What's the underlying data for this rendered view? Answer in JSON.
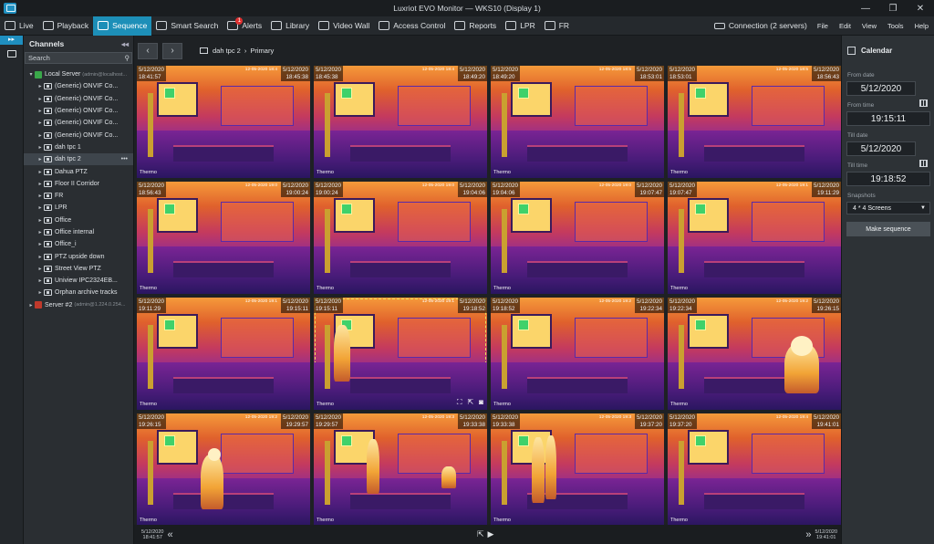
{
  "window": {
    "title": "Luxriot EVO Monitor — WKS10 (Display 1)",
    "min": "—",
    "max": "❐",
    "close": "✕"
  },
  "menu": {
    "items": [
      {
        "label": "Live",
        "icon": "monitor-icon",
        "active": false
      },
      {
        "label": "Playback",
        "icon": "play-icon",
        "active": false
      },
      {
        "label": "Sequence",
        "icon": "sequence-icon",
        "active": true
      },
      {
        "label": "Smart Search",
        "icon": "smart-search-icon",
        "active": false
      },
      {
        "label": "Alerts",
        "icon": "bell-icon",
        "active": false,
        "badge": "1"
      },
      {
        "label": "Library",
        "icon": "library-icon",
        "active": false
      },
      {
        "label": "Video Wall",
        "icon": "video-wall-icon",
        "active": false
      },
      {
        "label": "Access Control",
        "icon": "access-control-icon",
        "active": false
      },
      {
        "label": "Reports",
        "icon": "reports-icon",
        "active": false
      },
      {
        "label": "LPR",
        "icon": "lpr-icon",
        "active": false
      },
      {
        "label": "FR",
        "icon": "fr-icon",
        "active": false
      }
    ],
    "connection": "Connection (2 servers)",
    "right": [
      "File",
      "Edit",
      "View",
      "Tools",
      "Help"
    ]
  },
  "channels": {
    "title": "Channels",
    "search_placeholder": "Search",
    "tree": [
      {
        "label": "Local Server",
        "sub": "(admin@localhost...",
        "kind": "server",
        "color": "#3aa84a"
      },
      {
        "label": "(Generic) ONVIF Co...",
        "kind": "camera"
      },
      {
        "label": "(Generic) ONVIF Co...",
        "kind": "camera"
      },
      {
        "label": "(Generic) ONVIF Co...",
        "kind": "camera"
      },
      {
        "label": "(Generic) ONVIF Co...",
        "kind": "camera"
      },
      {
        "label": "(Generic) ONVIF Co...",
        "kind": "camera"
      },
      {
        "label": "dah tpc 1",
        "kind": "camera"
      },
      {
        "label": "dah tpc 2",
        "kind": "camera",
        "selected": true
      },
      {
        "label": "Dahua PTZ",
        "kind": "camera"
      },
      {
        "label": "Floor II Corridor",
        "kind": "camera"
      },
      {
        "label": "FR",
        "kind": "camera"
      },
      {
        "label": "LPR",
        "kind": "camera"
      },
      {
        "label": "Office",
        "kind": "camera"
      },
      {
        "label": "Office internal",
        "kind": "camera"
      },
      {
        "label": "Office_i",
        "kind": "camera"
      },
      {
        "label": "PTZ upside down",
        "kind": "camera"
      },
      {
        "label": "Street View PTZ",
        "kind": "camera"
      },
      {
        "label": "Uniview IPC2324EB...",
        "kind": "camera"
      },
      {
        "label": "Orphan archive tracks",
        "kind": "camera"
      },
      {
        "label": "Server #2",
        "sub": "(admin@1.224.0.254...",
        "kind": "server",
        "color": "#c0392b"
      }
    ]
  },
  "viewer": {
    "breadcrumb": {
      "camera": "dah tpc 2",
      "stream": "Primary"
    },
    "tiles": [
      {
        "date": "5/12/2020",
        "start": "18:41:57",
        "end": "18:45:38",
        "ts": "12-05-2020 18:4"
      },
      {
        "date": "5/12/2020",
        "start": "18:45:38",
        "end": "18:49:20",
        "ts": "12-05-2020 18:4"
      },
      {
        "date": "5/12/2020",
        "start": "18:49:20",
        "end": "18:53:01",
        "ts": "12-05-2020 18:5"
      },
      {
        "date": "5/12/2020",
        "start": "18:53:01",
        "end": "18:56:43",
        "ts": "12-05-2020 18:5"
      },
      {
        "date": "5/12/2020",
        "start": "18:56:43",
        "end": "19:00:24",
        "ts": "12-05-2020 19:0"
      },
      {
        "date": "5/12/2020",
        "start": "19:00:24",
        "end": "19:04:06",
        "ts": "12-05-2020 19:0"
      },
      {
        "date": "5/12/2020",
        "start": "19:04:06",
        "end": "19:07:47",
        "ts": "12-05-2020 19:0"
      },
      {
        "date": "5/12/2020",
        "start": "19:07:47",
        "end": "19:11:29",
        "ts": "12-05-2020 19:1"
      },
      {
        "date": "5/12/2020",
        "start": "19:11:29",
        "end": "19:15:11",
        "ts": "12-05-2020 19:1"
      },
      {
        "date": "5/12/2020",
        "start": "19:15:11",
        "end": "19:18:52",
        "ts": "12-05-2020 19:1",
        "selected": true
      },
      {
        "date": "5/12/2020",
        "start": "19:18:52",
        "end": "19:22:34",
        "ts": "12-05-2020 19:2"
      },
      {
        "date": "5/12/2020",
        "start": "19:22:34",
        "end": "19:26:15",
        "ts": "12-05-2020 19:2"
      },
      {
        "date": "5/12/2020",
        "start": "19:26:15",
        "end": "19:29:57",
        "ts": "12-05-2020 19:2"
      },
      {
        "date": "5/12/2020",
        "start": "19:29:57",
        "end": "19:33:38",
        "ts": "12-05-2020 19:3"
      },
      {
        "date": "5/12/2020",
        "start": "19:33:38",
        "end": "19:37:20",
        "ts": "12-05-2020 19:3"
      },
      {
        "date": "5/12/2020",
        "start": "19:37:20",
        "end": "19:41:01",
        "ts": "12-05-2020 19:4"
      }
    ],
    "tile_label": "Thermo",
    "timeline": {
      "start_date": "5/12/2020",
      "start_time": "18:41:57",
      "end_date": "5/12/2020",
      "end_time": "19:41:01"
    }
  },
  "calendar": {
    "title": "Calendar",
    "from_date_label": "From date",
    "from_date": "5/12/2020",
    "from_time_label": "From time",
    "from_time": "19:15:11",
    "till_date_label": "Till date",
    "till_date": "5/12/2020",
    "till_time_label": "Till time",
    "till_time": "19:18:52",
    "snapshots_label": "Snapshots",
    "snapshots_value": "4 * 4 Screens",
    "make_sequence": "Make sequence"
  }
}
